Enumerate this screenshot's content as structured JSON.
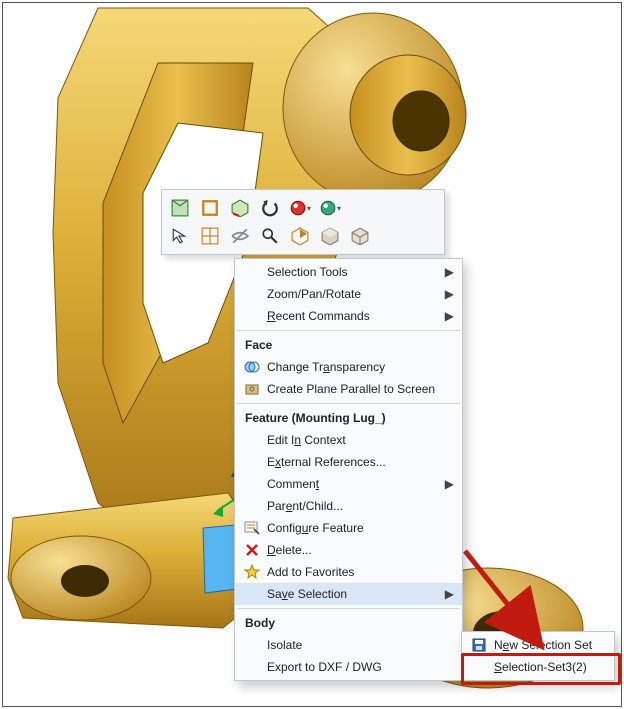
{
  "menu": {
    "selection_tools": "Selection Tools",
    "zoom_pan_rotate": "Zoom/Pan/Rotate",
    "recent_commands": "Recent Commands",
    "section_face": "Face",
    "change_transparency": "Change Transparency",
    "create_plane_parallel": "Create Plane Parallel to Screen",
    "section_feature": "Feature (Mounting Lug_)",
    "edit_in_context": "Edit In Context",
    "external_references": "External References...",
    "comment": "Comment",
    "parent_child": "Parent/Child...",
    "configure_feature": "Configure Feature",
    "delete": "Delete...",
    "add_to_favorites": "Add to Favorites",
    "save_selection": "Save Selection",
    "section_body": "Body",
    "isolate": "Isolate",
    "export_dxf": "Export to DXF / DWG"
  },
  "submenu": {
    "new_selection_set": "New Selection Set",
    "selection_set_32": "Selection-Set3(2)"
  },
  "colors": {
    "part_gold": "#d9a62e",
    "part_gold_light": "#f4d373",
    "part_gold_dark": "#9a6e13",
    "select_blue": "#56b6f2",
    "highlight_red": "#c11a0e"
  }
}
